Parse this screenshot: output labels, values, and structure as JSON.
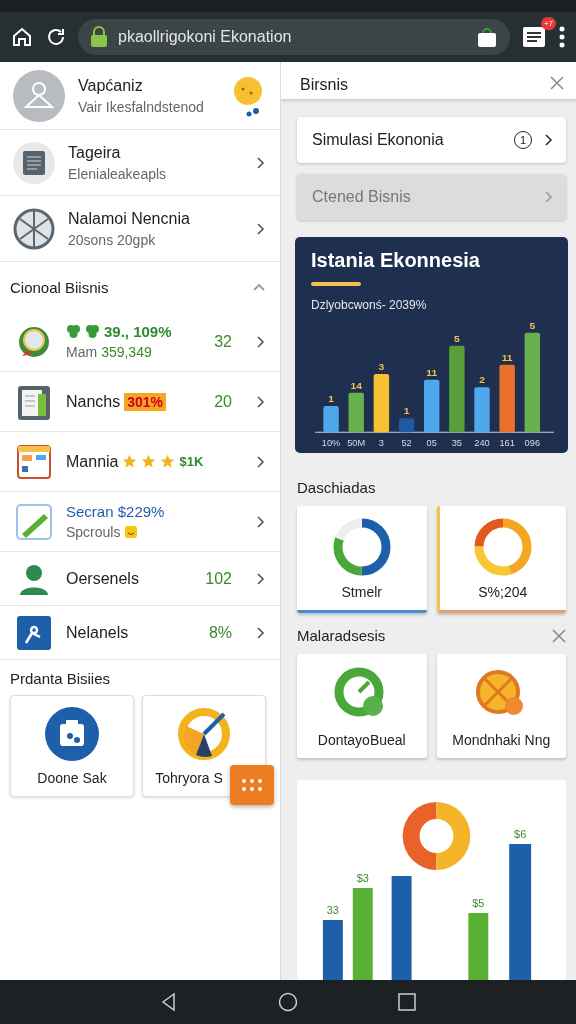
{
  "toolbar": {
    "url": "pkaollrigokoni Ekonation",
    "notification_count": "+7"
  },
  "profile": {
    "name": "Vapćaniz",
    "subtitle": "Vair Ikesfalndstenod"
  },
  "nav_items": [
    {
      "title": "Tageira",
      "subtitle": "Elenialeakeapls"
    },
    {
      "title": "Nalamoi Nencnia",
      "subtitle": "20sons 20gpk"
    }
  ],
  "section": {
    "title": "Cionoal Biisnis",
    "expanded": true,
    "rows": [
      {
        "kind": "stat",
        "title": "39., 109%",
        "subtitle": "Mam",
        "subtitle_value": "359,349",
        "value": "32"
      },
      {
        "kind": "badge",
        "title": "Nanchs",
        "badge": "301%",
        "value": "20"
      },
      {
        "kind": "rating",
        "title": "Mannia",
        "stars": 3,
        "suffix": "$1K"
      },
      {
        "kind": "link",
        "title": "Secran $229%",
        "subtitle": "Spcrouls"
      },
      {
        "kind": "plain",
        "title": "Oersenels",
        "value": "102"
      },
      {
        "kind": "plain",
        "title": "Nelanels",
        "value": "8%"
      }
    ]
  },
  "products": {
    "title": "Prdanta Bisiies",
    "cards": [
      {
        "label": "Doone Sak"
      },
      {
        "label": "Tohryora S"
      }
    ]
  },
  "panel": {
    "title": "Birsnis",
    "menu": [
      {
        "label": "Simulasi Ekononia",
        "count": "1",
        "disabled": false
      },
      {
        "label": "Ctened Bisnis",
        "disabled": true
      }
    ],
    "chart": {
      "title": "Istania Ekonnesia",
      "subtitle": "Dzlyobcwonś- 2039%",
      "bar_labels": [
        "1",
        "14",
        "3",
        "1",
        "11",
        "5",
        "2",
        "11",
        "5"
      ],
      "axis_labels": [
        "10%",
        "50M",
        "3",
        "52",
        "05",
        "35",
        "240",
        "161",
        "096"
      ]
    },
    "dashboards": {
      "title": "Daschiadas",
      "cards": [
        {
          "label": "Stmelr"
        },
        {
          "label": "S%;204"
        }
      ]
    },
    "analysis": {
      "title": "Malaradsesis",
      "cards": [
        {
          "label": "DontayoBueal"
        },
        {
          "label": "Mondnhaki Nng"
        }
      ]
    },
    "bottom_chart": {
      "labels": [
        "33",
        "$3",
        "$5",
        "$6"
      ]
    }
  }
}
